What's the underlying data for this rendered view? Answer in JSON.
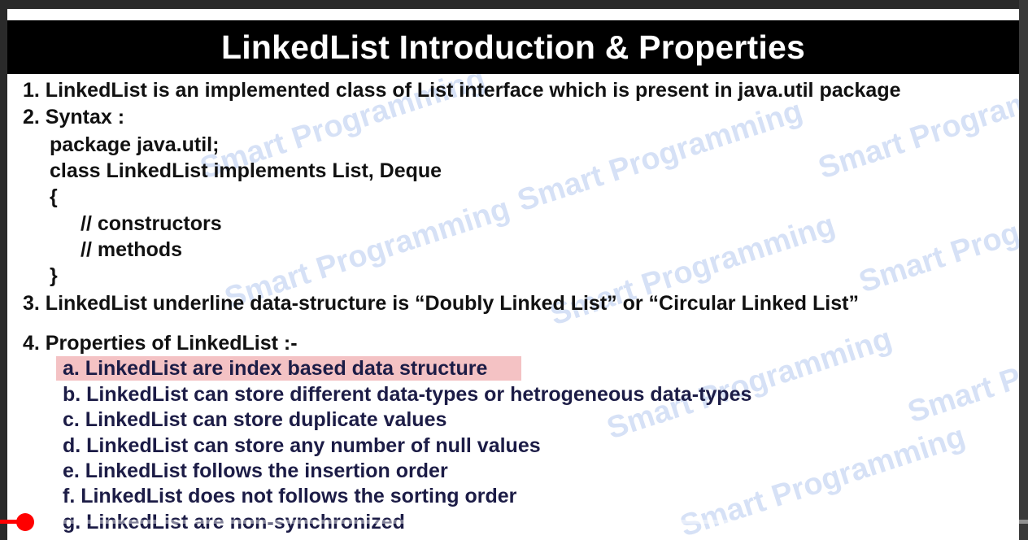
{
  "title": "LinkedList Introduction & Properties",
  "watermark_text": "Smart Programming",
  "points": [
    "1. LinkedList is an implemented class of List interface which is present in java.util package",
    "2. Syntax :"
  ],
  "syntax_lines": [
    "package java.util;",
    "class LinkedList implements List, Deque",
    "{",
    "// constructors",
    "// methods",
    "}"
  ],
  "point3": "3. LinkedList underline data-structure is “Doubly Linked List” or “Circular Linked List”",
  "point4": "4. Properties of LinkedList :-",
  "properties": [
    "a. LinkedList are index based data structure",
    "b. LinkedList can store different data-types or hetrogeneous data-types",
    "c. LinkedList can store duplicate values",
    "d. LinkedList can store any number of null values",
    "e. LinkedList follows the insertion order",
    "f. LinkedList does not follows the sorting order",
    "g. LinkedList are non-synchronized"
  ],
  "colors": {
    "title_bg": "#000000",
    "highlight": "#f4c2c4",
    "progress": "#ff0000"
  },
  "video_progress_fraction": 0.025
}
